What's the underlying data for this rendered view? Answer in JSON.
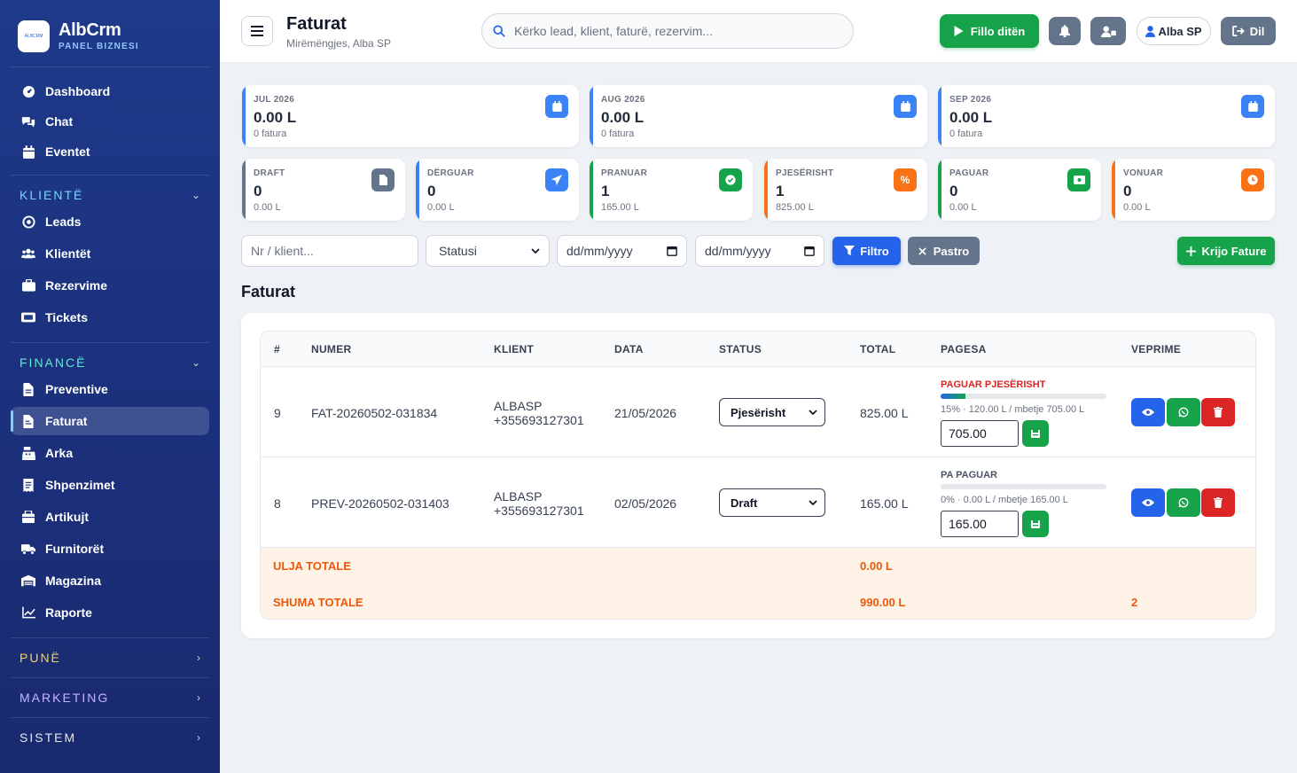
{
  "brand": {
    "logo_text": "ALBCRM",
    "name": "AlbCrm",
    "sub": "PANEL BIZNESI"
  },
  "sidebar": {
    "top_items": [
      {
        "label": "Dashboard",
        "icon": "gauge-icon"
      },
      {
        "label": "Chat",
        "icon": "chat-icon"
      },
      {
        "label": "Eventet",
        "icon": "calendar-icon"
      }
    ],
    "sections": {
      "klientet": {
        "label": "KLIENTË",
        "color": "#7dd3fc"
      },
      "finance": {
        "label": "FINANCË",
        "color": "#5eead4"
      },
      "pune": {
        "label": "PUNË",
        "color": "#fcd34d"
      },
      "marketing": {
        "label": "MARKETING",
        "color": "#c4b5fd"
      },
      "sistem": {
        "label": "SISTEM",
        "color": "#e5e7eb"
      }
    },
    "klientet_items": [
      {
        "label": "Leads",
        "icon": "target-icon"
      },
      {
        "label": "Klientët",
        "icon": "users-icon"
      },
      {
        "label": "Rezervime",
        "icon": "briefcase-icon"
      },
      {
        "label": "Tickets",
        "icon": "ticket-icon"
      }
    ],
    "finance_items": [
      {
        "label": "Preventive",
        "icon": "file-invoice-icon"
      },
      {
        "label": "Faturat",
        "icon": "file-icon",
        "active": true
      },
      {
        "label": "Arka",
        "icon": "cash-register-icon"
      },
      {
        "label": "Shpenzimet",
        "icon": "receipt-icon"
      },
      {
        "label": "Artikujt",
        "icon": "box-icon"
      },
      {
        "label": "Furnitorët",
        "icon": "truck-icon"
      },
      {
        "label": "Magazina",
        "icon": "warehouse-icon"
      },
      {
        "label": "Raporte",
        "icon": "chart-icon"
      }
    ]
  },
  "header": {
    "title": "Faturat",
    "subtitle": "Mirëmëngjes, Alba SP",
    "search_placeholder": "Kërko lead, klient, faturë, rezervim...",
    "start_day_label": "Fillo ditën",
    "user_label": "Alba SP",
    "logout_label": "Dil"
  },
  "month_cards": [
    {
      "label": "JUL 2026",
      "value": "0.00 L",
      "sub": "0 fatura"
    },
    {
      "label": "AUG 2026",
      "value": "0.00 L",
      "sub": "0 fatura"
    },
    {
      "label": "SEP 2026",
      "value": "0.00 L",
      "sub": "0 fatura"
    }
  ],
  "status_cards": [
    {
      "label": "DRAFT",
      "value": "0",
      "sub": "0.00 L",
      "color": "#64748b",
      "icon": "file-icon"
    },
    {
      "label": "DËRGUAR",
      "value": "0",
      "sub": "0.00 L",
      "color": "#3b82f6",
      "icon": "paper-plane-icon"
    },
    {
      "label": "PRANUAR",
      "value": "1",
      "sub": "165.00 L",
      "color": "#16a34a",
      "icon": "check-circle-icon"
    },
    {
      "label": "PJESËRISHT",
      "value": "1",
      "sub": "825.00 L",
      "color": "#f97316",
      "icon": "percent-icon"
    },
    {
      "label": "PAGUAR",
      "value": "0",
      "sub": "0.00 L",
      "color": "#16a34a",
      "icon": "money-icon"
    },
    {
      "label": "VONUAR",
      "value": "0",
      "sub": "0.00 L",
      "color": "#f97316",
      "icon": "clock-icon"
    }
  ],
  "filters": {
    "search_placeholder": "Nr / klient...",
    "status_value": "Statusi",
    "date_from_placeholder": "dd/mm/yyyy",
    "date_to_placeholder": "dd/mm/yyyy",
    "filter_label": "Filtro",
    "clear_label": "Pastro",
    "create_label": "Krijo Fature"
  },
  "section_title": "Faturat",
  "table": {
    "columns": [
      "#",
      "NUMER",
      "KLIENT",
      "DATA",
      "STATUS",
      "TOTAL",
      "PAGESA",
      "VEPRIME"
    ],
    "rows": [
      {
        "id": "9",
        "number": "FAT-20260502-031834",
        "client": "ALBASP",
        "phone": "+355693127301",
        "date": "21/05/2026",
        "status": "Pjesërisht",
        "total": "825.00 L",
        "pay_title": "PAGUAR PJESËRISHT",
        "pay_color": "#dc2626",
        "progress": 15,
        "pay_info": "15% · 120.00 L / mbetje 705.00 L",
        "pay_input": "705.00"
      },
      {
        "id": "8",
        "number": "PREV-20260502-031403",
        "client": "ALBASP",
        "phone": "+355693127301",
        "date": "02/05/2026",
        "status": "Draft",
        "total": "165.00 L",
        "pay_title": "PA PAGUAR",
        "pay_color": "#4b5563",
        "progress": 0,
        "pay_info": "0% · 0.00 L / mbetje 165.00 L",
        "pay_input": "165.00"
      }
    ],
    "totals": {
      "vat_label": "ULJA TOTALE",
      "vat_value": "0.00 L",
      "sum_label": "SHUMA TOTALE",
      "sum_value": "990.00 L",
      "count": "2"
    }
  }
}
